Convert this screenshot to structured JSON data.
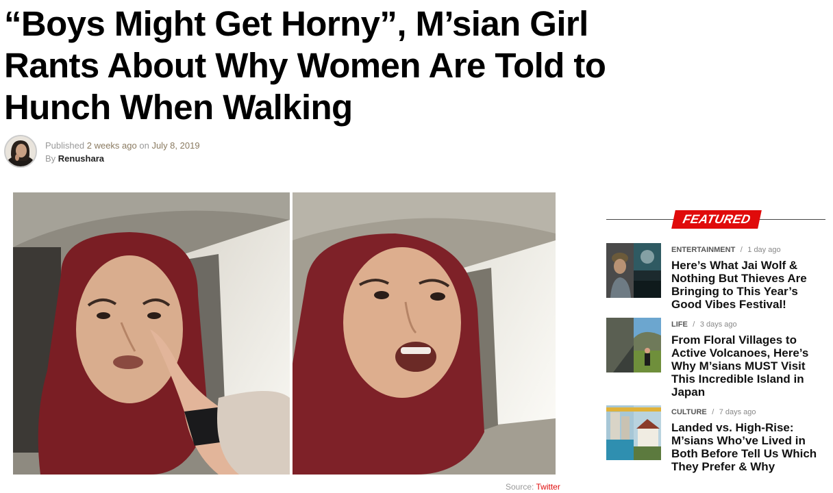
{
  "article": {
    "title": "“Boys Might Get Horny”, M’sian Girl Rants About Why Women Are Told to Hunch When Walking",
    "published_label": "Published",
    "published_relative": "2 weeks ago",
    "on_label": "on",
    "published_date": "July 8, 2019",
    "by_label": "By",
    "author": "Renushara",
    "image_source_label": "Source:",
    "image_source": "Twitter"
  },
  "sidebar": {
    "featured_label": "FEATURED",
    "items": [
      {
        "category": "ENTERTAINMENT",
        "separator": "/",
        "time": "1 day ago",
        "title": "Here’s What Jai Wolf & Nothing But Thieves Are Bringing to This Year’s Good Vibes Festival!"
      },
      {
        "category": "LIFE",
        "separator": "/",
        "time": "3 days ago",
        "title": "From Floral Villages to Active Volcanoes, Here’s Why M’sians MUST Visit This Incredible Island in Japan"
      },
      {
        "category": "CULTURE",
        "separator": "/",
        "time": "7 days ago",
        "title": "Landed vs. High-Rise: M’sians Who’ve Lived in Both Before Tell Us Which They Prefer & Why"
      }
    ]
  },
  "colors": {
    "accent_red": "#e00b0b",
    "meta_gray": "#999999",
    "headline": "#000000"
  }
}
